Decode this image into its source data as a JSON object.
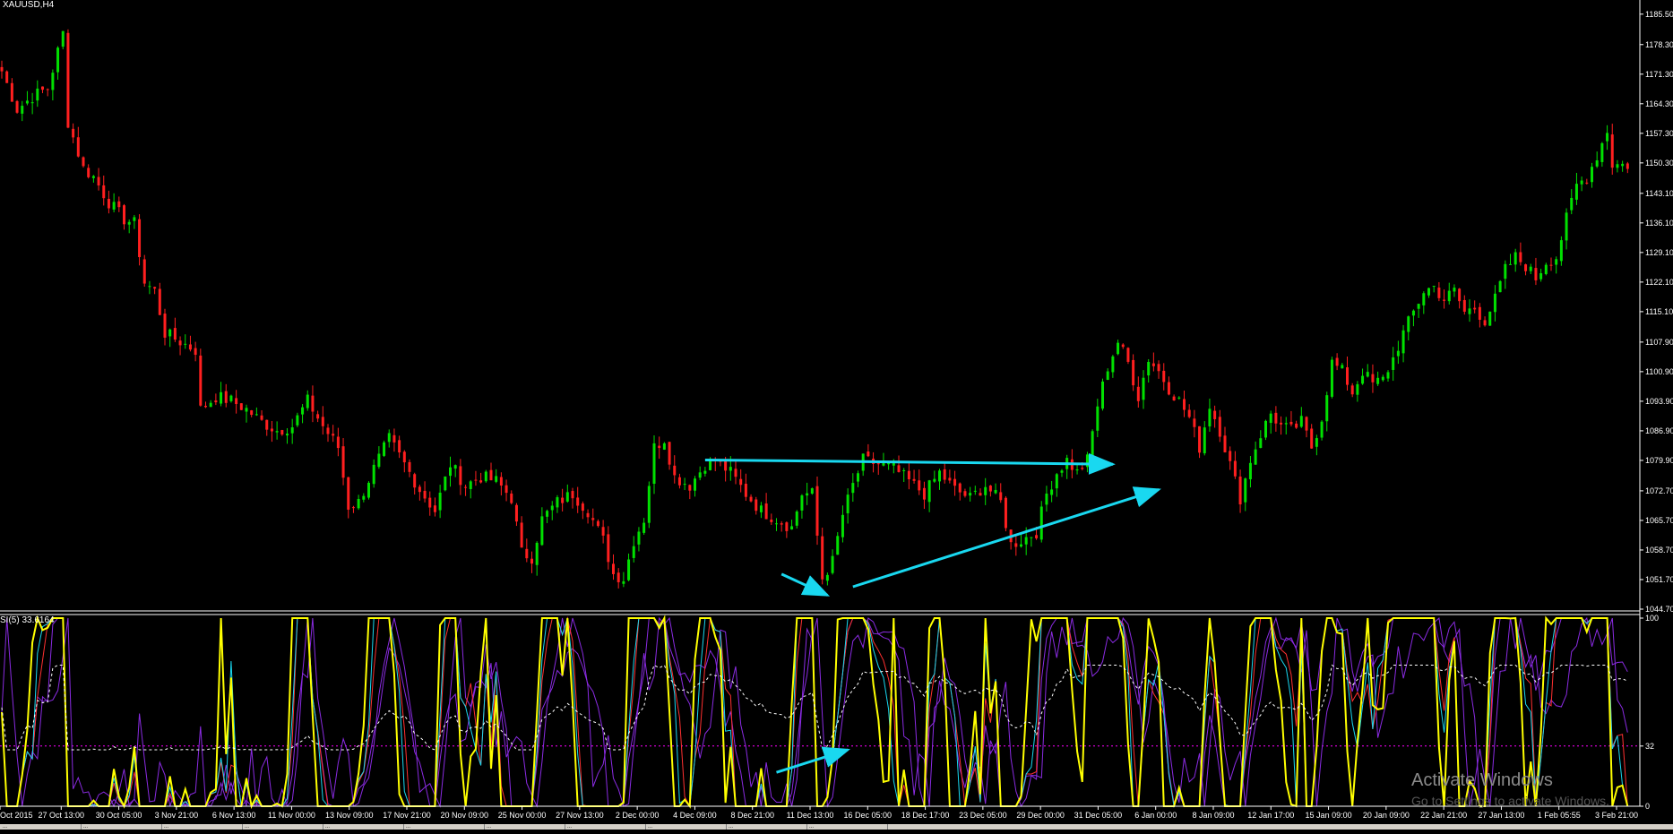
{
  "chart_title": "XAUUSD,H4",
  "indicator_title": "SI(5) 33.6164",
  "watermark": {
    "line1": "Activate Windows",
    "line2": "Go to Settings to activate Windows."
  },
  "tabs": [
    "...",
    "...",
    "...",
    "...",
    "...",
    "...",
    "...",
    "...",
    "...",
    "...",
    "..."
  ],
  "colors": {
    "background": "#000000",
    "up_candle": "#00e000",
    "down_candle": "#ff1f1f",
    "trendline": "#19d8f0",
    "axis": "#ffffff",
    "rsi_main": "#ffff00",
    "rsi_cyan": "#19d8f0",
    "rsi_purple": "#8a2be2",
    "rsi_red": "#ff3030",
    "rsi_level": "#ff00ff"
  },
  "chart_data": [
    {
      "type": "candlestick",
      "title": "XAUUSD,H4",
      "ylim": [
        1044.7,
        1188.0
      ],
      "price_ticks": [
        "1185.50",
        "1178.30",
        "1171.30",
        "1164.30",
        "1157.30",
        "1150.30",
        "1143.10",
        "1136.10",
        "1129.10",
        "1122.10",
        "1115.10",
        "1107.90",
        "1100.90",
        "1093.90",
        "1086.90",
        "1079.90",
        "1072.70",
        "1065.70",
        "1058.70",
        "1051.70",
        "1044.70"
      ],
      "x_labels": [
        "Oct 2015",
        "27 Oct 13:00",
        "30 Oct 05:00",
        "3 Nov 21:00",
        "6 Nov 13:00",
        "11 Nov 00:00",
        "13 Nov 09:00",
        "17 Nov 21:00",
        "20 Nov 09:00",
        "25 Nov 00:00",
        "27 Nov 13:00",
        "2 Dec 00:00",
        "4 Dec 09:00",
        "8 Dec 21:00",
        "11 Dec 13:00",
        "16 Dec 05:00",
        "18 Dec 17:00",
        "23 Dec 05:00",
        "29 Dec 00:00",
        "31 Dec 05:00",
        "6 Jan 00:00",
        "8 Jan 09:00",
        "12 Jan 17:00",
        "15 Jan 09:00",
        "20 Jan 09:00",
        "22 Jan 21:00",
        "27 Jan 13:00",
        "1 Feb 05:55",
        "3 Feb 21:00"
      ],
      "path": [
        [
          0,
          1172
        ],
        [
          3,
          1163
        ],
        [
          6,
          1166
        ],
        [
          9,
          1168
        ],
        [
          12,
          1181
        ],
        [
          13,
          1160
        ],
        [
          16,
          1149
        ],
        [
          18,
          1147
        ],
        [
          21,
          1141
        ],
        [
          24,
          1137
        ],
        [
          26,
          1136
        ],
        [
          28,
          1122
        ],
        [
          30,
          1120
        ],
        [
          32,
          1110
        ],
        [
          35,
          1108
        ],
        [
          38,
          1106
        ],
        [
          39,
          1092
        ],
        [
          42,
          1095
        ],
        [
          45,
          1094
        ],
        [
          48,
          1092
        ],
        [
          51,
          1089
        ],
        [
          54,
          1087
        ],
        [
          57,
          1088
        ],
        [
          60,
          1094
        ],
        [
          63,
          1088
        ],
        [
          66,
          1083
        ],
        [
          68,
          1069
        ],
        [
          70,
          1070
        ],
        [
          73,
          1078
        ],
        [
          76,
          1085
        ],
        [
          79,
          1079
        ],
        [
          82,
          1073
        ],
        [
          85,
          1068
        ],
        [
          88,
          1079
        ],
        [
          91,
          1074
        ],
        [
          94,
          1076
        ],
        [
          97,
          1075
        ],
        [
          100,
          1071
        ],
        [
          102,
          1058
        ],
        [
          104,
          1057
        ],
        [
          106,
          1066
        ],
        [
          109,
          1070
        ],
        [
          112,
          1072
        ],
        [
          115,
          1068
        ],
        [
          118,
          1061
        ],
        [
          120,
          1053
        ],
        [
          122,
          1052
        ],
        [
          124,
          1061
        ],
        [
          126,
          1066
        ],
        [
          128,
          1083
        ],
        [
          130,
          1085
        ],
        [
          132,
          1076
        ],
        [
          135,
          1074
        ],
        [
          138,
          1079
        ],
        [
          140,
          1080
        ],
        [
          143,
          1077
        ],
        [
          146,
          1072
        ],
        [
          149,
          1068
        ],
        [
          152,
          1066
        ],
        [
          155,
          1064
        ],
        [
          157,
          1072
        ],
        [
          159,
          1072
        ],
        [
          161,
          1052
        ],
        [
          163,
          1056
        ],
        [
          165,
          1067
        ],
        [
          167,
          1074
        ],
        [
          169,
          1080
        ],
        [
          172,
          1079
        ],
        [
          175,
          1078
        ],
        [
          178,
          1075
        ],
        [
          181,
          1072
        ],
        [
          184,
          1077
        ],
        [
          187,
          1073
        ],
        [
          190,
          1071
        ],
        [
          193,
          1074
        ],
        [
          196,
          1070
        ],
        [
          198,
          1060
        ],
        [
          200,
          1061
        ],
        [
          203,
          1063
        ],
        [
          205,
          1072
        ],
        [
          207,
          1077
        ],
        [
          209,
          1080
        ],
        [
          211,
          1077
        ],
        [
          213,
          1080
        ],
        [
          215,
          1093
        ],
        [
          217,
          1102
        ],
        [
          219,
          1108
        ],
        [
          221,
          1103
        ],
        [
          223,
          1095
        ],
        [
          225,
          1104
        ],
        [
          227,
          1101
        ],
        [
          229,
          1097
        ],
        [
          231,
          1094
        ],
        [
          233,
          1090
        ],
        [
          235,
          1083
        ],
        [
          237,
          1093
        ],
        [
          239,
          1087
        ],
        [
          241,
          1079
        ],
        [
          243,
          1071
        ],
        [
          245,
          1080
        ],
        [
          247,
          1086
        ],
        [
          249,
          1091
        ],
        [
          251,
          1088
        ],
        [
          253,
          1087
        ],
        [
          255,
          1089
        ],
        [
          257,
          1083
        ],
        [
          259,
          1090
        ],
        [
          261,
          1103
        ],
        [
          263,
          1101
        ],
        [
          265,
          1096
        ],
        [
          267,
          1101
        ],
        [
          269,
          1098
        ],
        [
          271,
          1099
        ],
        [
          273,
          1104
        ],
        [
          275,
          1110
        ],
        [
          277,
          1115
        ],
        [
          279,
          1120
        ],
        [
          281,
          1121
        ],
        [
          283,
          1118
        ],
        [
          285,
          1120
        ],
        [
          287,
          1115
        ],
        [
          289,
          1116
        ],
        [
          291,
          1113
        ],
        [
          293,
          1118
        ],
        [
          295,
          1125
        ],
        [
          297,
          1128
        ],
        [
          299,
          1126
        ],
        [
          301,
          1123
        ],
        [
          303,
          1127
        ],
        [
          305,
          1128
        ],
        [
          307,
          1137
        ],
        [
          309,
          1145
        ],
        [
          311,
          1147
        ],
        [
          313,
          1152
        ],
        [
          315,
          1158
        ],
        [
          316,
          1150
        ]
      ],
      "annotations": [
        {
          "type": "horizontal-line",
          "from": [
            138,
            1080
          ],
          "to": [
            218,
            1079
          ]
        },
        {
          "type": "arrow",
          "from": [
            153,
            1053
          ],
          "to": [
            162,
            1048
          ]
        },
        {
          "type": "arrow",
          "from": [
            167,
            1050
          ],
          "to": [
            227,
            1073
          ]
        }
      ]
    },
    {
      "type": "line",
      "title": "SI(5) 33.6164",
      "ylim": [
        0,
        100
      ],
      "y_ticks": [
        "100",
        "32",
        "0"
      ],
      "level": 32,
      "series_count": 6
    }
  ]
}
